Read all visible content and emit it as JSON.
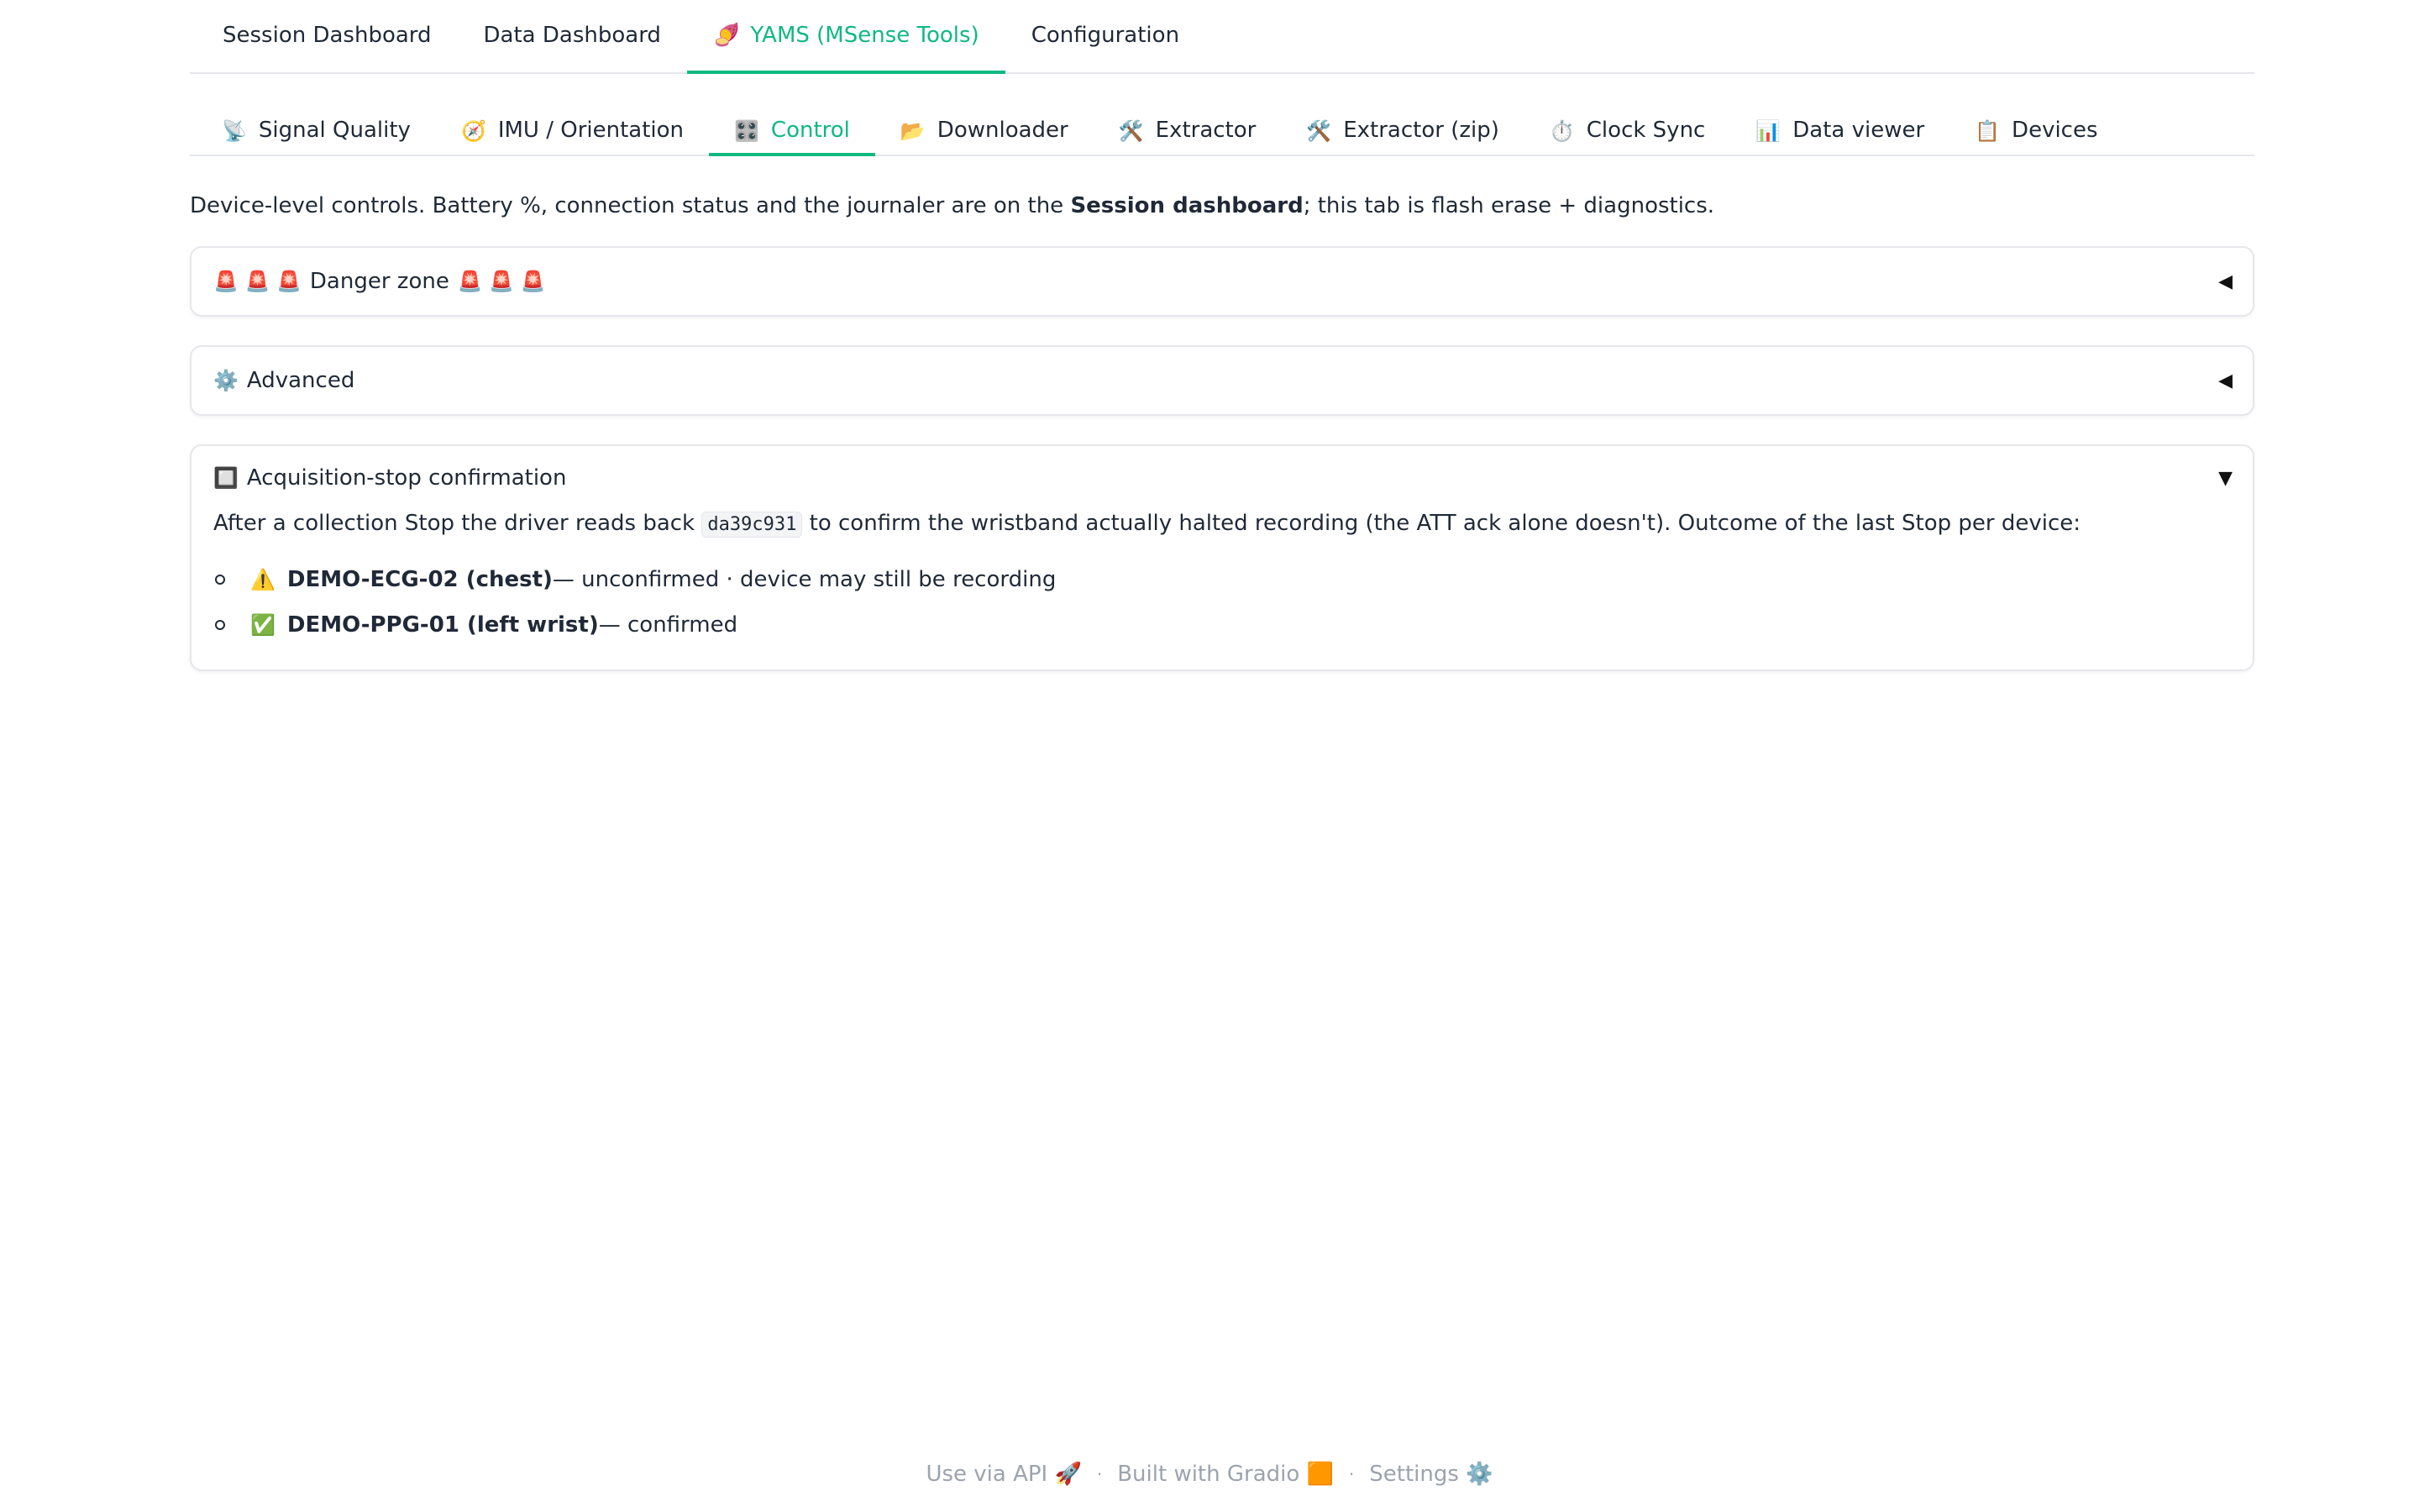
{
  "top_tabs": [
    {
      "label": "Session Dashboard",
      "icon": ""
    },
    {
      "label": "Data Dashboard",
      "icon": ""
    },
    {
      "label": "YAMS (MSense Tools)",
      "icon": "🍠",
      "active": true
    },
    {
      "label": "Configuration",
      "icon": ""
    }
  ],
  "sub_tabs": [
    {
      "label": "Signal Quality",
      "icon": "📡"
    },
    {
      "label": "IMU / Orientation",
      "icon": "🧭"
    },
    {
      "label": "Control",
      "icon": "🎛️",
      "active": true
    },
    {
      "label": "Downloader",
      "icon": "📂"
    },
    {
      "label": "Extractor",
      "icon": "🛠️"
    },
    {
      "label": "Extractor (zip)",
      "icon": "🛠️"
    },
    {
      "label": "Clock Sync",
      "icon": "⏱️"
    },
    {
      "label": "Data viewer",
      "icon": "📊"
    },
    {
      "label": "Devices",
      "icon": "📋"
    }
  ],
  "intro": {
    "part1": "Device-level controls. Battery %, connection status and the journaler are on the ",
    "bold": "Session dashboard",
    "part2": "; this tab is flash erase + diagnostics."
  },
  "danger_zone": {
    "label": "Danger zone",
    "icon_prefix": "🚨 🚨 🚨",
    "icon_suffix": "🚨 🚨 🚨",
    "caret": "◀"
  },
  "advanced": {
    "label": "Advanced",
    "icon": "⚙️",
    "caret": "◀"
  },
  "acq_stop": {
    "label": "Acquisition-stop confirmation",
    "icon": "🔲",
    "caret": "▼",
    "desc_part1": "After a collection Stop the driver reads back ",
    "code": "da39c931",
    "desc_part2": " to confirm the wristband actually halted recording (the ATT ack alone doesn't). Outcome of the last Stop per device:",
    "items": [
      {
        "icon": "⚠️",
        "name": "DEMO-ECG-02 (chest)",
        "status": " — unconfirmed · device may still be recording"
      },
      {
        "icon": "✅",
        "name": "DEMO-PPG-01 (left wrist)",
        "status": " — confirmed"
      }
    ]
  },
  "footer": {
    "api": "Use via API",
    "api_icon": "🚀",
    "gradio": "Built with Gradio",
    "gradio_icon": "🟧",
    "settings": "Settings",
    "settings_icon": "⚙️",
    "sep": "·"
  },
  "colors": {
    "accent": "#10b981",
    "border": "#e5e7eb",
    "muted": "#9ca3af"
  }
}
